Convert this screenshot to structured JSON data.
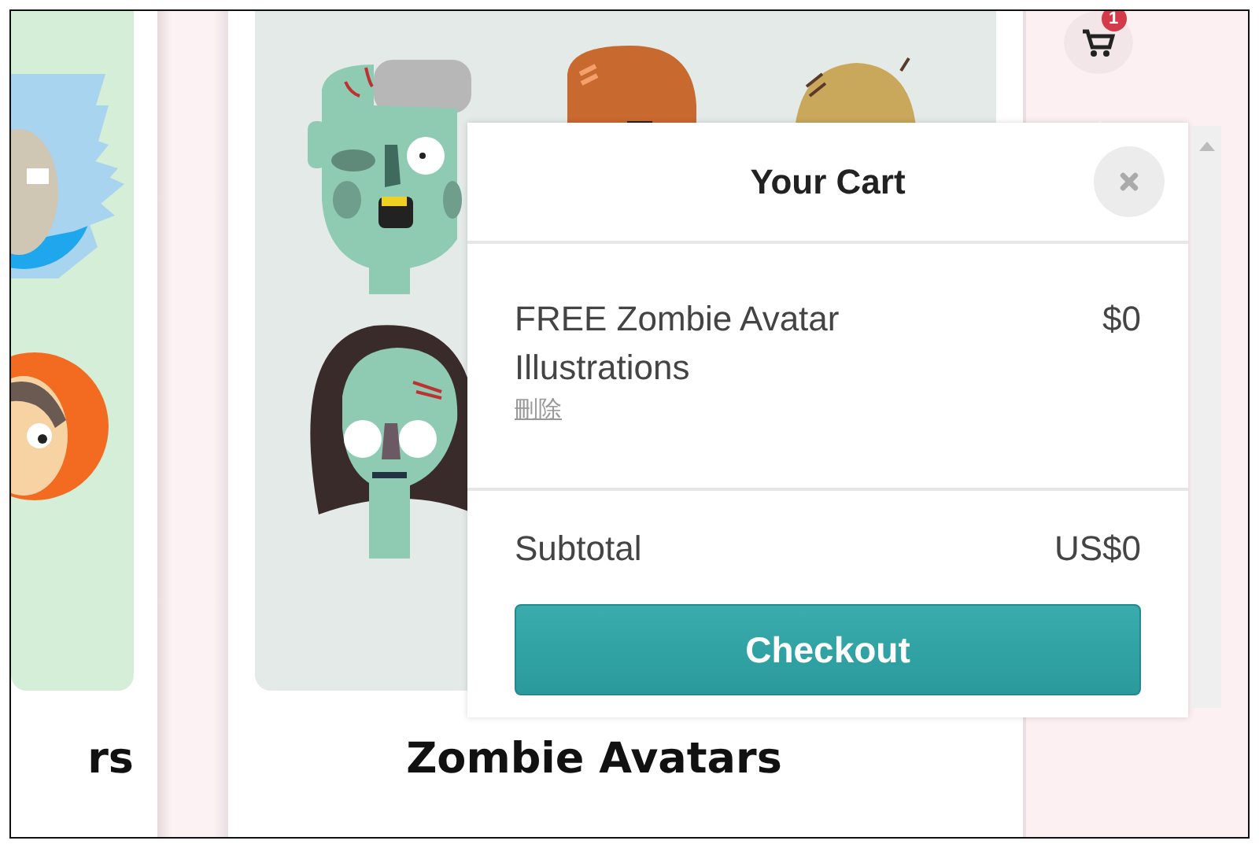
{
  "cards": [
    {
      "kind": "cartoon",
      "title": "rs"
    },
    {
      "kind": "zombie",
      "title": "Zombie Avatars"
    }
  ],
  "cart_button": {
    "badge": "1"
  },
  "cart": {
    "title": "Your Cart",
    "items": [
      {
        "name": "FREE Zombie Avatar Illustrations",
        "price": "$0",
        "remove_label": "刪除"
      }
    ],
    "subtotal_label": "Subtotal",
    "subtotal": "US$0",
    "checkout_label": "Checkout"
  }
}
